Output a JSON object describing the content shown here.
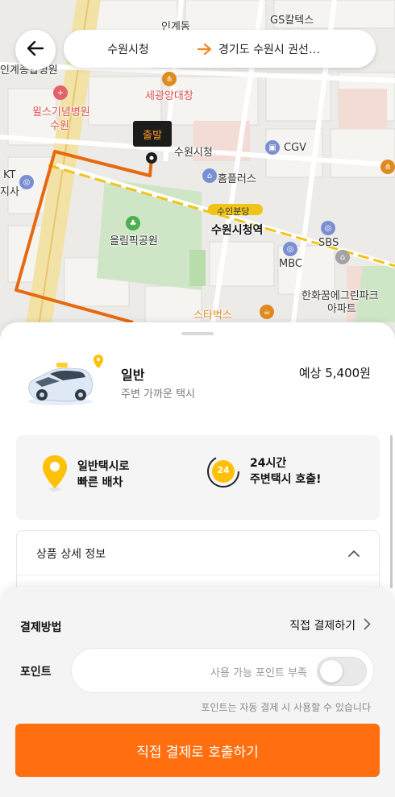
{
  "map": {
    "labels": {
      "incheondong": "인계동",
      "gs_caltex": "GS칼텍스",
      "gyeongjin_hosp": "인계종합병원",
      "wells_hospital": "윌스기념병원",
      "wells_hospital_2": "수원",
      "sewang": "세광양대창",
      "suwon_cityhall_poi": "수원시청",
      "cgv": "CGV",
      "homeplus": "홈플러스",
      "kt": "KT",
      "kt_2": "지사",
      "olympic_park": "올림픽공원",
      "suin_bundang": "수인분당",
      "suwon_station": "수원시청역",
      "sbs": "SBS",
      "mbc": "MBC",
      "hanwha": "한화꿈에그린파크",
      "hanwha_2": "아파트",
      "starbucks": "스타벅스"
    },
    "start_tag": "출발",
    "route_color": "#e8680f"
  },
  "header": {
    "from": "수원시청",
    "to": "경기도 수원시 권선…"
  },
  "taxi": {
    "name": "일반",
    "desc": "주변 가까운 택시",
    "fare": "예상 5,400원"
  },
  "features": [
    {
      "line1": "일반택시로",
      "line2": "빠른 배차",
      "icon": "location-pin-icon"
    },
    {
      "line1": "24시간",
      "line2": "주변택시 호출!",
      "icon": "clock-24-icon",
      "badge": "24"
    }
  ],
  "detail": {
    "title": "상품 상세 정보"
  },
  "payment": {
    "label": "결제방법",
    "method": "직접 결제하기",
    "point_label": "포인트",
    "point_status": "사용 가능 포인트 부족",
    "point_note": "포인트는 자동 결제 시 사용할 수 있습니다",
    "call_button": "직접 결제로 호출하기"
  },
  "colors": {
    "accent": "#ff6f0f",
    "pin_yellow": "#ffc107",
    "route": "#e8680f"
  }
}
